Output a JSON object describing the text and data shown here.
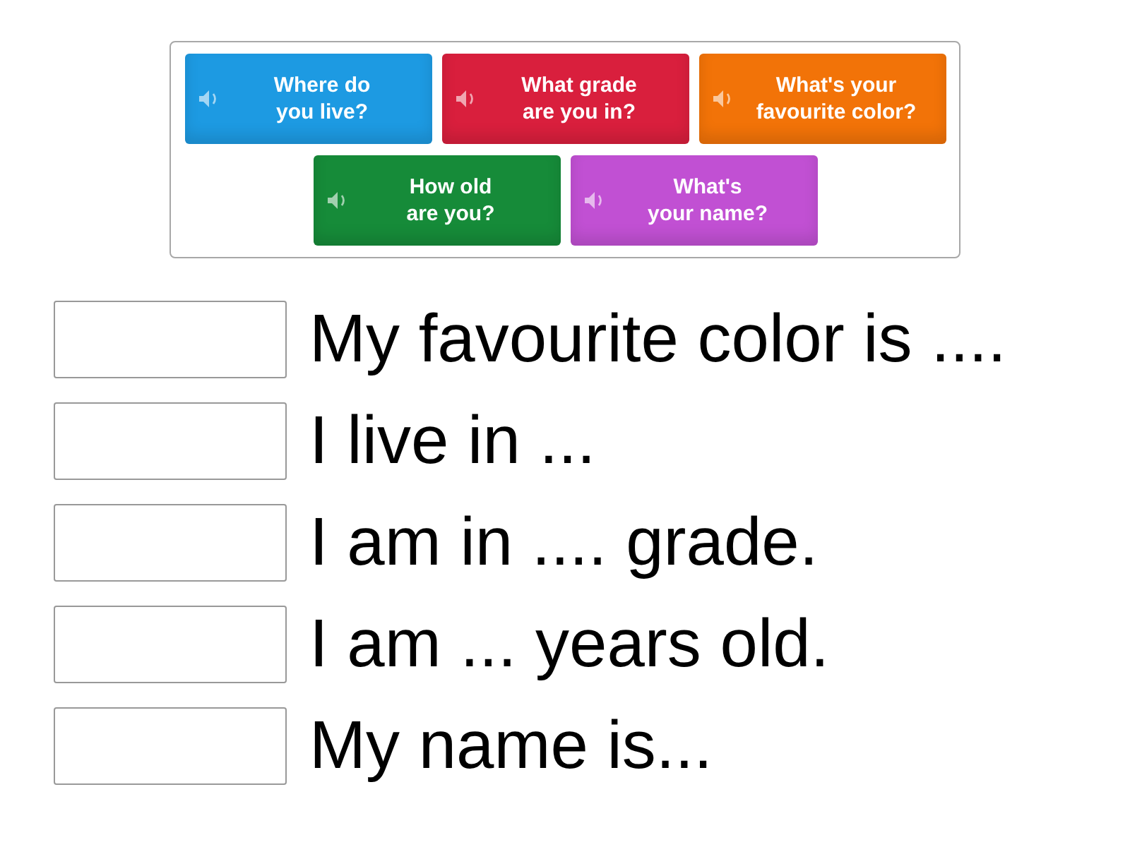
{
  "tiles": [
    {
      "label": "Where do\nyou live?",
      "color": "#1d9ae2"
    },
    {
      "label": "What grade\nare you in?",
      "color": "#d91f3d"
    },
    {
      "label": "What's your\nfavourite color?",
      "color": "#f27308"
    },
    {
      "label": "How old\nare you?",
      "color": "#168b39"
    },
    {
      "label": "What's\nyour name?",
      "color": "#c150d3"
    }
  ],
  "rows": [
    {
      "text": "My favourite color is ...."
    },
    {
      "text": "I live in ..."
    },
    {
      "text": "I am in .... grade."
    },
    {
      "text": "I am ... years old."
    },
    {
      "text": "My name is..."
    }
  ]
}
